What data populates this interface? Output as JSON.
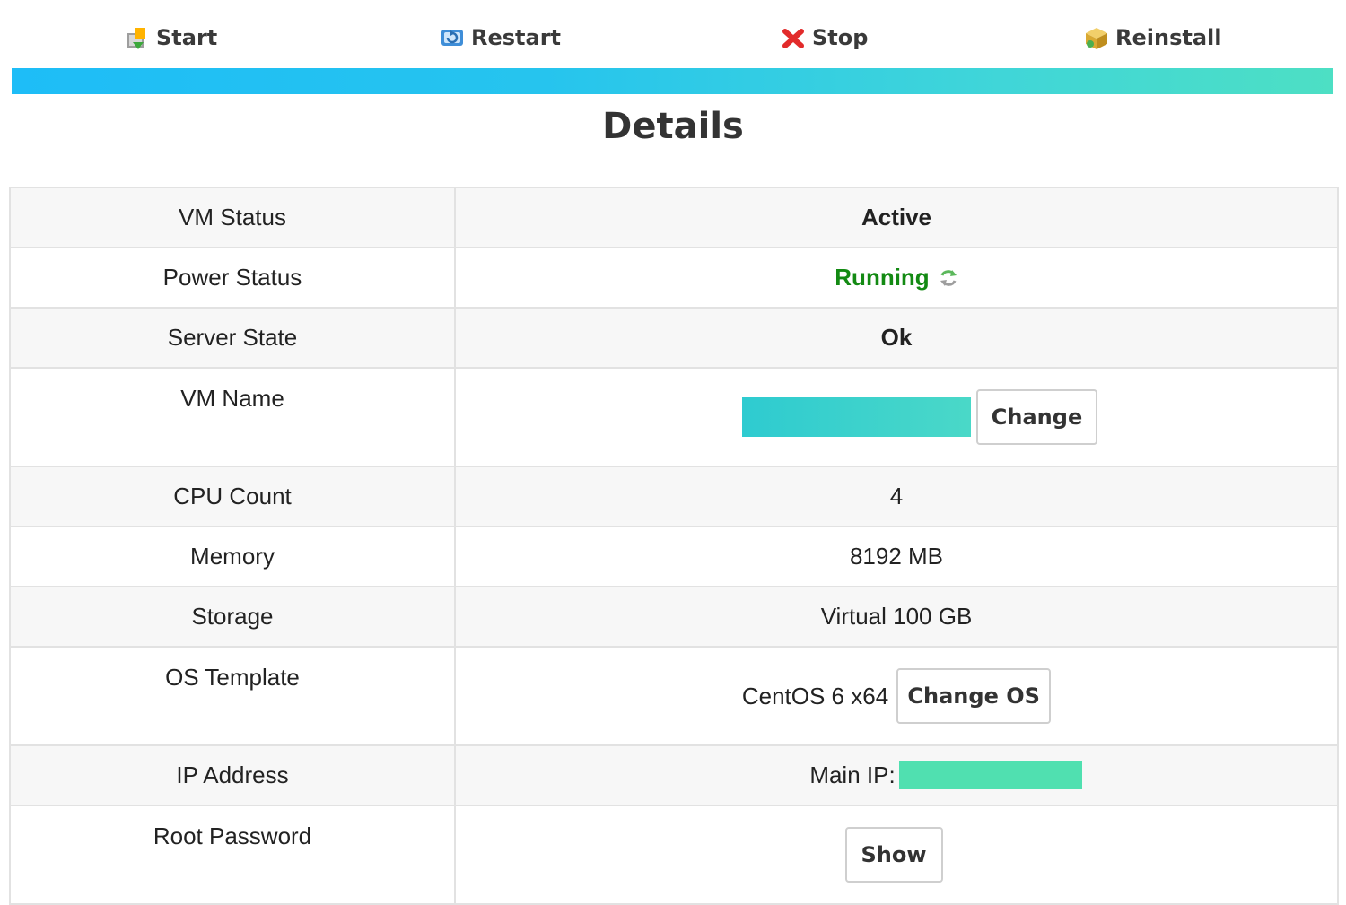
{
  "toolbar": {
    "start_label": "Start",
    "restart_label": "Restart",
    "stop_label": "Stop",
    "reinstall_label": "Reinstall",
    "icons": [
      "start-icon",
      "restart-icon",
      "stop-icon",
      "reinstall-icon"
    ]
  },
  "accent_gradient": [
    "#1ebdf7",
    "#4ddfc4"
  ],
  "title": "Details",
  "details": {
    "vm_status": {
      "label": "VM Status",
      "value": "Active"
    },
    "power_status": {
      "label": "Power Status",
      "value": "Running",
      "value_color": "#138a13",
      "icon": "refresh-icon"
    },
    "server_state": {
      "label": "Server State",
      "value": "Ok"
    },
    "vm_name": {
      "label": "VM Name",
      "button": "Change"
    },
    "cpu_count": {
      "label": "CPU Count",
      "value": "4"
    },
    "memory": {
      "label": "Memory",
      "value": "8192 MB"
    },
    "storage": {
      "label": "Storage",
      "value": "Virtual 100 GB"
    },
    "os_template": {
      "label": "OS Template",
      "value": "CentOS 6 x64",
      "button": "Change OS"
    },
    "ip_address": {
      "label": "IP Address",
      "prefix": "Main IP:"
    },
    "root_password": {
      "label": "Root Password",
      "button": "Show"
    }
  }
}
